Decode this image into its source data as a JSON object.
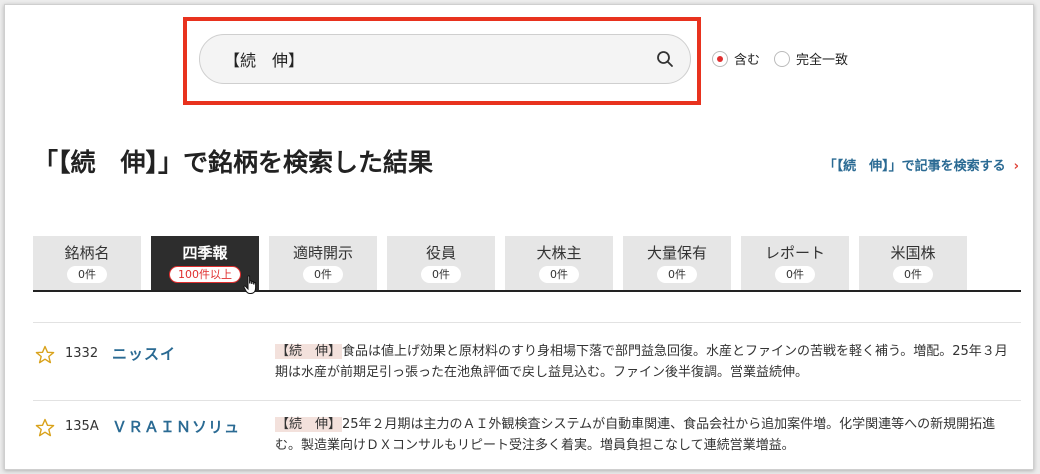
{
  "search": {
    "query": "【続　伸】",
    "option_contains": "含む",
    "option_exact": "完全一致"
  },
  "page": {
    "title": "「【続　伸】」で銘柄を検索した結果",
    "article_link": "「【続　伸】」で記事を検索する",
    "article_link_arrow": "›"
  },
  "tabs": [
    {
      "label": "銘柄名",
      "count": "0件"
    },
    {
      "label": "四季報",
      "count": "100件以上"
    },
    {
      "label": "適時開示",
      "count": "0件"
    },
    {
      "label": "役員",
      "count": "0件"
    },
    {
      "label": "大株主",
      "count": "0件"
    },
    {
      "label": "大量保有",
      "count": "0件"
    },
    {
      "label": "レポート",
      "count": "0件"
    },
    {
      "label": "米国株",
      "count": "0件"
    }
  ],
  "results": [
    {
      "code": "1332",
      "name": "ニッスイ",
      "tag": "【続　伸】",
      "text": "食品は値上げ効果と原材料のすり身相場下落で部門益急回復。水産とファインの苦戦を軽く補う。増配。25年３月期は水産が前期足引っ張った在池魚評価で戻し益見込む。ファイン後半復調。営業益続伸。"
    },
    {
      "code": "135A",
      "name": "ＶＲＡＩＮソリュ",
      "tag": "【続　伸】",
      "text": "25年２月期は主力のＡＩ外観検査システムが自動車関連、食品会社から追加案件増。化学関連等への新規開拓進む。製造業向けＤＸコンサルもリピート受注多く着実。増員負担こなして連続営業増益。"
    }
  ],
  "colors": {
    "highlight": "#e8321e",
    "link": "#2a6a93",
    "active_tab": "#2d2d2d",
    "accent_red": "#e02f2f"
  }
}
